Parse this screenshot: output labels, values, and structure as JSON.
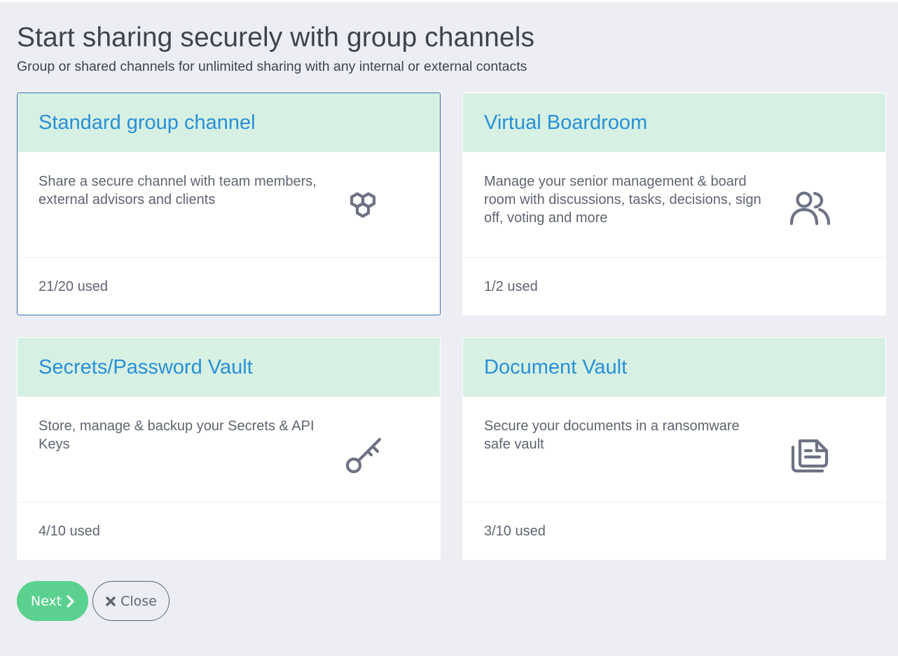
{
  "header": {
    "title": "Start sharing securely with group channels",
    "subtitle": "Group or shared channels for unlimited sharing with any internal or external contacts"
  },
  "cards": [
    {
      "title": "Standard group channel",
      "description": "Share a secure channel with team members, external advisors and clients",
      "usage": "21/20 used",
      "icon": "hexagons-icon",
      "selected": true
    },
    {
      "title": "Virtual Boardroom",
      "description": "Manage your senior management & board room with discussions, tasks, decisions, sign off, voting and more",
      "usage": "1/2 used",
      "icon": "users-icon",
      "selected": false
    },
    {
      "title": "Secrets/Password Vault",
      "description": "Store, manage & backup your Secrets & API Keys",
      "usage": "4/10 used",
      "icon": "key-icon",
      "selected": false
    },
    {
      "title": "Document Vault",
      "description": "Secure your documents in a ransomware safe vault",
      "usage": "3/10 used",
      "icon": "documents-icon",
      "selected": false
    }
  ],
  "buttons": {
    "next_label": "Next",
    "close_label": "Close"
  },
  "colors": {
    "accent": "#2a8fd6",
    "header_bg": "#d6f1e3",
    "next_button": "#5bd18f",
    "selected_border": "#3f6fb0",
    "page_bg": "#eceef3"
  }
}
